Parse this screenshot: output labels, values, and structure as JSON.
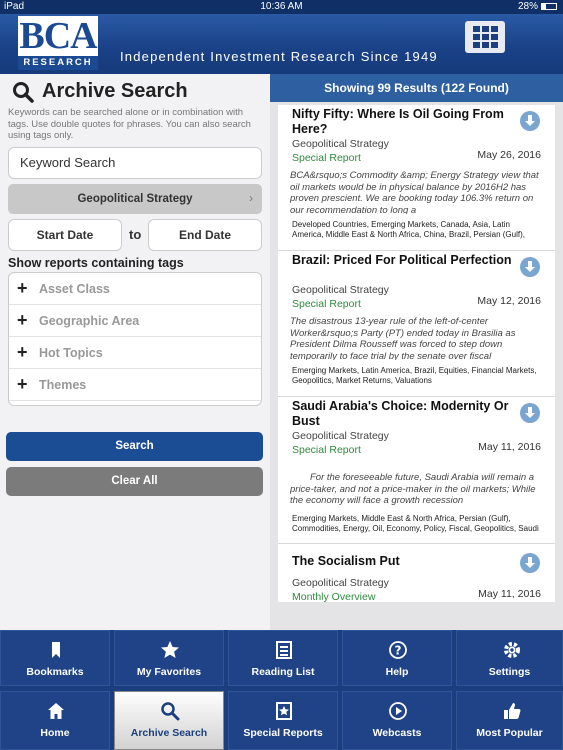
{
  "status": {
    "left": "iPad",
    "time": "10:36 AM",
    "battery": "28%"
  },
  "header": {
    "logo_main": "BCA",
    "logo_sub": "RESEARCH",
    "tagline": "Independent Investment Research Since 1949"
  },
  "search": {
    "title": "Archive Search",
    "help": "Keywords can be searched alone or in combination with tags. Use double quotes for phrases. You can also search using tags only.",
    "keyword_placeholder": "Keyword Search",
    "category": "Geopolitical Strategy",
    "start_date": "Start Date",
    "to": "to",
    "end_date": "End Date",
    "tags_label": "Show reports containing tags",
    "tags": [
      "Asset Class",
      "Geographic Area",
      "Hot Topics",
      "Themes"
    ],
    "search_button": "Search",
    "clear_button": "Clear All"
  },
  "results": {
    "header": "Showing 99 Results (122 Found)",
    "items": [
      {
        "title": "Nifty Fifty: Where Is Oil Going From Here?",
        "publication": "Geopolitical Strategy",
        "type": "Special Report",
        "date": "May 26, 2016",
        "summary": "BCA&rsquo;s Commodity &amp; Energy Strategy view that oil markets would be in physical balance by 2016H2 has proven prescient. We are booking today 106.3% return on our recommendation to long a",
        "tags": "Developed Countries, Emerging Markets, Canada, Asia, Latin America, Middle East & North Africa, China, Brazil, Persian (Gulf), Commoditie..."
      },
      {
        "title": "Brazil: Priced For Political Perfection",
        "publication": "Geopolitical Strategy",
        "type": "Special Report",
        "date": "May 12, 2016",
        "summary": "The disastrous 13-year rule of the left-of-center Worker&rsquo;s Party (PT) ended today in Brasilia as President Dilma Rousseff was forced to step down temporarily to face trial by the senate over fiscal",
        "tags": "Emerging Markets, Latin America, Brazil, Equities, Financial Markets, Geopolitics, Market Returns, Valuations"
      },
      {
        "title": "Saudi Arabia's Choice: Modernity Or Bust",
        "publication": "Geopolitical Strategy",
        "type": "Special Report",
        "date": "May 11, 2016",
        "summary": "For the foreseeable future, Saudi Arabia will remain a price-taker, and not a price-maker in the oil markets; While the economy will face a growth recession",
        "tags": "Emerging Markets, Middle East & North Africa, Persian (Gulf), Commodities, Energy, Oil, Economy, Policy, Fiscal, Geopolitics, Saudi ..."
      },
      {
        "title": "The Socialism Put",
        "publication": "Geopolitical Strategy",
        "type": "Monthly Overview",
        "date": "May 11, 2016",
        "summary": "",
        "tags": ""
      }
    ]
  },
  "nav": [
    {
      "label": "Bookmarks",
      "icon": "bookmark-icon"
    },
    {
      "label": "My Favorites",
      "icon": "star-icon"
    },
    {
      "label": "Reading List",
      "icon": "list-icon"
    },
    {
      "label": "Help",
      "icon": "help-icon"
    },
    {
      "label": "Settings",
      "icon": "gear-icon"
    },
    {
      "label": "Home",
      "icon": "home-icon"
    },
    {
      "label": "Archive Search",
      "icon": "search-icon",
      "active": true
    },
    {
      "label": "Special Reports",
      "icon": "special-reports-icon"
    },
    {
      "label": "Webcasts",
      "icon": "play-icon"
    },
    {
      "label": "Most Popular",
      "icon": "thumbs-up-icon"
    }
  ],
  "colors": {
    "brand": "#1b3f7e",
    "accent": "#2e5fa0",
    "type_green": "#2e8a3c"
  }
}
